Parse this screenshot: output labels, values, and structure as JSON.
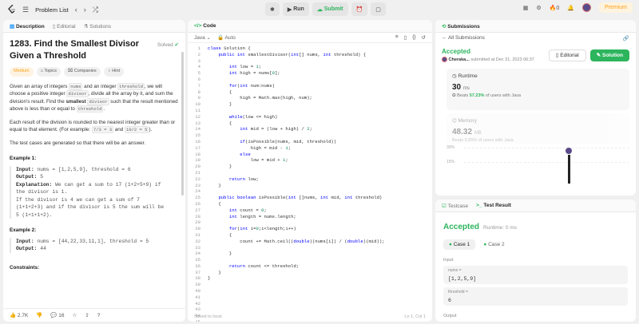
{
  "topbar": {
    "problem_list": "Problem List",
    "run": "Run",
    "submit": "Submit",
    "coins": "0",
    "premium": "Premium"
  },
  "desc": {
    "tabs": [
      "Description",
      "Editorial",
      "Solutions"
    ],
    "title": "1283. Find the Smallest Divisor Given a Threshold",
    "solved": "Solved",
    "tags": [
      "Medium",
      "Topics",
      "Companies",
      "Hint"
    ],
    "p1_a": "Given an array of integers ",
    "p1_b": " and an integer ",
    "p1_c": ", we will choose a positive integer ",
    "p1_d": ", divide all the array by it, and sum the division's result. Find the ",
    "p1_e": "smallest",
    "p1_f": " such that the result mentioned above is less than or equal to ",
    "p1_g": ".",
    "code_nums": "nums",
    "code_threshold": "threshold",
    "code_divisor": "divisor",
    "p2_a": "Each result of the division is rounded to the nearest integer greater than or equal to that element. (For example: ",
    "p2_b": "7/3 = 3",
    "p2_c": " and ",
    "p2_d": "10/2 = 5",
    "p2_e": ").",
    "p3": "The test cases are generated so that there will be an answer.",
    "ex1_title": "Example 1:",
    "ex1_input_label": "Input:",
    "ex1_input": " nums = [1,2,5,9], threshold = 6",
    "ex1_output_label": "Output:",
    "ex1_output": " 5",
    "ex1_expl_label": "Explanation:",
    "ex1_expl": " We can get a sum to 17 (1+2+5+9) if\nthe divisor is 1.\nIf the divisor is 4 we can get a sum of 7\n(1+1+2+3) and if the divisor is 5 the sum will be\n5 (1+1+1+2).",
    "ex2_title": "Example 2:",
    "ex2_input_label": "Input:",
    "ex2_input": " nums = [44,22,33,11,1], threshold = 5",
    "ex2_output_label": "Output:",
    "ex2_output": " 44",
    "constraints": "Constraints:",
    "likes": "2.7K",
    "comments": "16"
  },
  "code": {
    "header": "Code",
    "language": "Java",
    "auto": "Auto",
    "saved": "Saved to local",
    "cursor": "Ln 1, Col 1",
    "gutter": "1\n2\n3\n4\n5\n6\n7\n8\n9\n10\n11\n12\n13\n14\n15\n16\n17\n18\n19\n20\n21\n22\n23\n24\n25\n26\n27\n28\n29\n30\n31\n32\n33\n34\n35\n36\n37\n38\n39\n40\n41\n42\n43\n44\n45\n46\n47",
    "source": "class Solution {\n    public int smallestDivisor(int[] nums, int threshold) {\n\n        int low = 1;\n        int high = nums[0];\n\n        for(int num:nums)\n        {\n            high = Math.max(high, num);\n        }\n\n        while(low <= high)\n        {\n            int mid = (low + high) / 2;\n\n            if(isPossible(nums, mid, threshold))\n                high = mid - 1;\n            else\n                low = mid + 1;\n        }\n\n        return low;\n    }\n\n    public boolean isPossible(int []nums, int mid, int threshold)\n    {\n        int count = 0;\n        int length = nums.length;\n\n        for(int i=0;i<length;i++)\n        {\n            count += Math.ceil((double)(nums[i]) / (double)(mid));\n\n        }\n\n        return count <= threshold;\n    }\n}"
  },
  "subm": {
    "header": "Submissions",
    "all": "All Submissions",
    "accepted": "Accepted",
    "user": "Cheraka...",
    "submitted": "submitted at Dec 31, 2023 06:37",
    "editorial_btn": "Editorial",
    "solution_btn": "Solution",
    "runtime_label": "Runtime",
    "runtime_val": "30",
    "runtime_unit": "ms",
    "beats_pre": "Beats ",
    "beats_pct": "57.23%",
    "beats_post": " of users with Java",
    "memory_label": "Memory",
    "memory_val": "48.32",
    "memory_unit": "MB",
    "memory_beats": "Beats 5.85% of users with Java",
    "tick_top": "30%",
    "tick_bottom": "15%"
  },
  "test": {
    "tab1": "Testcase",
    "tab2": "Test Result",
    "accepted": "Accepted",
    "runtime": "Runtime: 0 ms",
    "case1": "Case 1",
    "case2": "Case 2",
    "input_label": "Input",
    "nums_label": "nums =",
    "nums_val": "[1,2,5,9]",
    "threshold_label": "threshold =",
    "threshold_val": "6",
    "output_label": "Output"
  }
}
